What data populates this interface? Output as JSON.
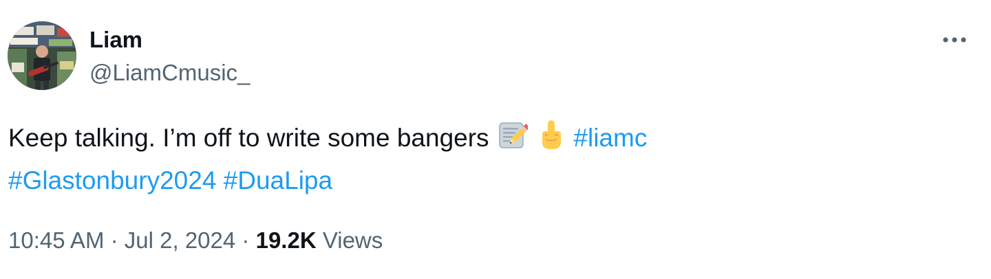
{
  "author": {
    "name": "Liam",
    "handle": "@LiamCmusic_"
  },
  "tweet": {
    "text_plain": "Keep talking. I’m off to write some bangers",
    "emojis": [
      "memo-emoji",
      "middle-finger-emoji"
    ],
    "hashtags": [
      "#liamc",
      "#Glastonbury2024",
      "#DuaLipa"
    ]
  },
  "meta": {
    "time": "10:45 AM",
    "separator": "·",
    "date": "Jul 2, 2024",
    "views_count": "19.2K",
    "views_label": "Views"
  },
  "colors": {
    "link": "#1d9bf0",
    "secondary_text": "#536471",
    "primary_text": "#0f1419"
  }
}
